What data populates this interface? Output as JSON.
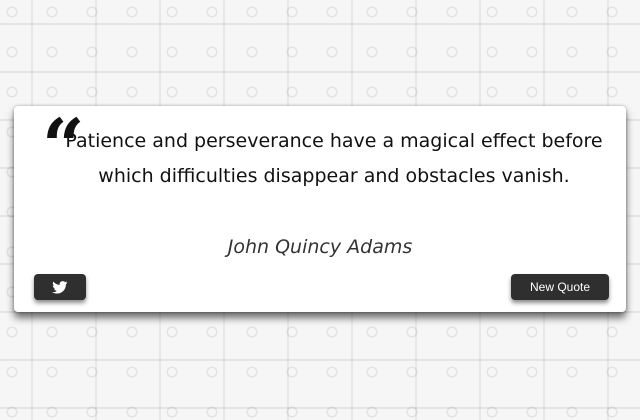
{
  "quote": {
    "mark": "“",
    "text": "Patience and perseverance have a magical effect before which difficulties disappear and obstacles vanish.",
    "author": "John Quincy Adams"
  },
  "buttons": {
    "tweet_icon": "twitter-icon",
    "new_quote_label": "New Quote"
  },
  "colors": {
    "button_bg": "#2f2f2f",
    "card_bg": "#ffffff",
    "text": "#111111"
  }
}
